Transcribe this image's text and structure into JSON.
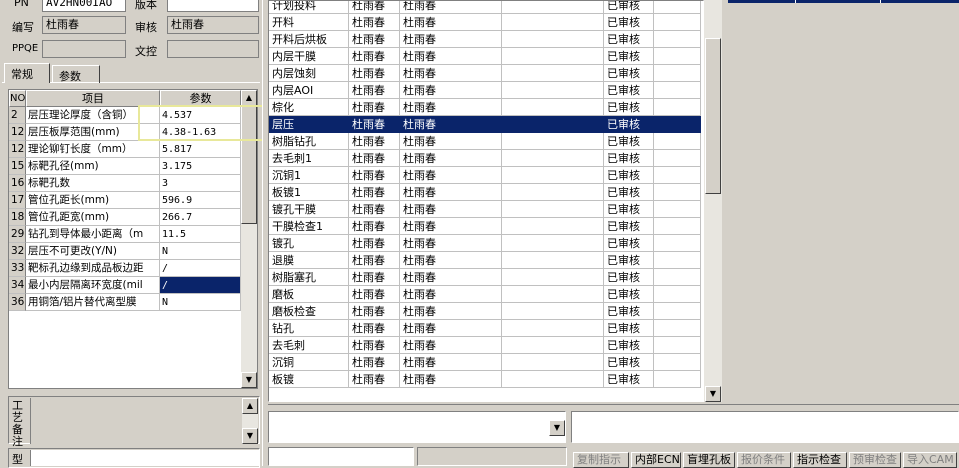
{
  "header": {
    "pn_label": "PN",
    "pn_value": "AV2HN00IAO",
    "version_label": "版本",
    "editor_label": "编写",
    "editor_value": "杜雨春",
    "reviewer_label": "审核",
    "reviewer_value": "杜雨春",
    "ppqe_label": "PPQE",
    "wenkong_label": "文控"
  },
  "tabs": [
    "常规",
    "参数"
  ],
  "param_table": {
    "headers": [
      "NO",
      "项目",
      "参数"
    ],
    "rows": [
      {
        "no": "2",
        "item": "层压理论厚度（含铜）",
        "param": "4.537"
      },
      {
        "no": "12",
        "item": "层压板厚范围(mm)",
        "param": "4.38-1.63"
      },
      {
        "no": "12",
        "item": "理论铆钉长度（mm）",
        "param": "5.817"
      },
      {
        "no": "15",
        "item": "标靶孔径(mm)",
        "param": "3.175"
      },
      {
        "no": "16",
        "item": "标靶孔数",
        "param": "3"
      },
      {
        "no": "17",
        "item": "管位孔距长(mm)",
        "param": "596.9"
      },
      {
        "no": "18",
        "item": "管位孔距宽(mm)",
        "param": "266.7"
      },
      {
        "no": "29",
        "item": "钻孔到导体最小距离（m",
        "param": "11.5"
      },
      {
        "no": "32",
        "item": "层压不可更改(Y/N)",
        "param": "N"
      },
      {
        "no": "33",
        "item": "靶标孔边缘到成品板边距",
        "param": "/"
      },
      {
        "no": "34",
        "item": "最小内层隔离环宽度(mil",
        "param": "/"
      },
      {
        "no": "36",
        "item": "用铜箔/铝片替代离型膜",
        "param": "N"
      }
    ]
  },
  "side_label_1": "工艺备注",
  "side_label_2": "型",
  "process_rows": [
    {
      "name": "计划投料",
      "c1": "杜雨春",
      "c2": "杜雨春",
      "status": "已审核"
    },
    {
      "name": "开料",
      "c1": "杜雨春",
      "c2": "杜雨春",
      "status": "已审核"
    },
    {
      "name": "开料后烘板",
      "c1": "杜雨春",
      "c2": "杜雨春",
      "status": "已审核"
    },
    {
      "name": "内层干膜",
      "c1": "杜雨春",
      "c2": "杜雨春",
      "status": "已审核"
    },
    {
      "name": "内层蚀刻",
      "c1": "杜雨春",
      "c2": "杜雨春",
      "status": "已审核"
    },
    {
      "name": "内层AOI",
      "c1": "杜雨春",
      "c2": "杜雨春",
      "status": "已审核"
    },
    {
      "name": "棕化",
      "c1": "杜雨春",
      "c2": "杜雨春",
      "status": "已审核"
    },
    {
      "name": "层压",
      "c1": "杜雨春",
      "c2": "杜雨春",
      "status": "已审核"
    },
    {
      "name": "树脂钻孔",
      "c1": "杜雨春",
      "c2": "杜雨春",
      "status": "已审核"
    },
    {
      "name": "去毛刺1",
      "c1": "杜雨春",
      "c2": "杜雨春",
      "status": "已审核"
    },
    {
      "name": "沉铜1",
      "c1": "杜雨春",
      "c2": "杜雨春",
      "status": "已审核"
    },
    {
      "name": "板镀1",
      "c1": "杜雨春",
      "c2": "杜雨春",
      "status": "已审核"
    },
    {
      "name": "镀孔干膜",
      "c1": "杜雨春",
      "c2": "杜雨春",
      "status": "已审核"
    },
    {
      "name": "干膜检查1",
      "c1": "杜雨春",
      "c2": "杜雨春",
      "status": "已审核"
    },
    {
      "name": "镀孔",
      "c1": "杜雨春",
      "c2": "杜雨春",
      "status": "已审核"
    },
    {
      "name": "退膜",
      "c1": "杜雨春",
      "c2": "杜雨春",
      "status": "已审核"
    },
    {
      "name": "树脂塞孔",
      "c1": "杜雨春",
      "c2": "杜雨春",
      "status": "已审核"
    },
    {
      "name": "磨板",
      "c1": "杜雨春",
      "c2": "杜雨春",
      "status": "已审核"
    },
    {
      "name": "磨板检查",
      "c1": "杜雨春",
      "c2": "杜雨春",
      "status": "已审核"
    },
    {
      "name": "钻孔",
      "c1": "杜雨春",
      "c2": "杜雨春",
      "status": "已审核"
    },
    {
      "name": "去毛刺",
      "c1": "杜雨春",
      "c2": "杜雨春",
      "status": "已审核"
    },
    {
      "name": "沉铜",
      "c1": "杜雨春",
      "c2": "杜雨春",
      "status": "已审核"
    },
    {
      "name": "板镀",
      "c1": "杜雨春",
      "c2": "杜雨春",
      "status": "已审核"
    }
  ],
  "buttons": [
    "复制指示",
    "内部ECN",
    "盲埋孔板",
    "报价条件",
    "指示检查",
    "预审检查",
    "导入CAM"
  ],
  "colors": {
    "selection": "#0a246a",
    "highlight_box": "#e8e89a",
    "face": "#d4d0c8"
  }
}
